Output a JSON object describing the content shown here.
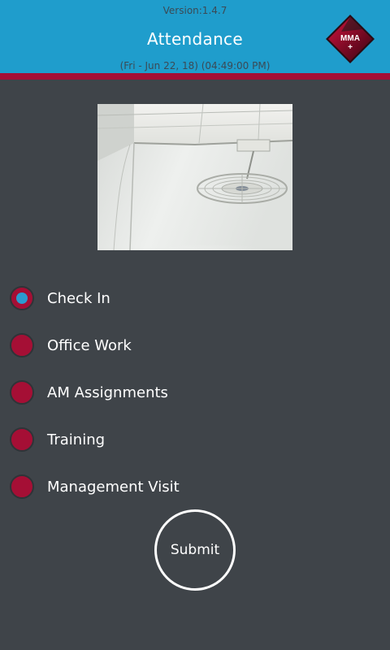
{
  "header": {
    "version": "Version:1.4.7",
    "title": "Attendance",
    "datetime": "(Fri - Jun 22, 18) (04:49:00 PM)",
    "logo_text": "MMA",
    "logo_plus": "+",
    "background_color": "#1f9dcc",
    "stripe_color": "#a50f35"
  },
  "photo": {
    "icon": "captured-photo"
  },
  "options": [
    {
      "label": "Check In",
      "selected": true
    },
    {
      "label": "Office Work",
      "selected": false
    },
    {
      "label": "AM Assignments",
      "selected": false
    },
    {
      "label": "Training",
      "selected": false
    },
    {
      "label": "Management Visit",
      "selected": false
    }
  ],
  "submit": {
    "label": "Submit"
  },
  "colors": {
    "background": "#3f4449",
    "radio": "#a50f35",
    "radio_selected_dot": "#2b9bd0"
  }
}
